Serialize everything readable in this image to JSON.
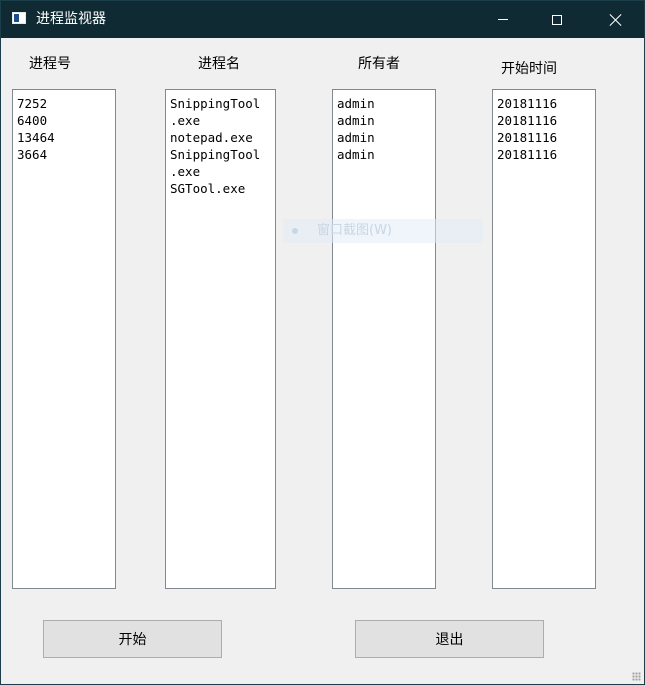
{
  "window": {
    "title": "进程监视器"
  },
  "columns": {
    "pid": {
      "label": "进程号",
      "items": [
        "7252",
        "6400",
        "13464",
        "3664"
      ]
    },
    "name": {
      "label": "进程名",
      "items": [
        "SnippingTool",
        ".exe",
        "notepad.exe",
        "SnippingTool",
        ".exe",
        "SGTool.exe"
      ]
    },
    "owner": {
      "label": "所有者",
      "items": [
        "admin",
        "admin",
        "admin",
        "admin"
      ]
    },
    "start_time": {
      "label": "开始时间",
      "items": [
        "20181116",
        "20181116",
        "20181116",
        "20181116"
      ]
    }
  },
  "overlay": {
    "menu_item": "窗口截图(W)"
  },
  "buttons": {
    "start": "开始",
    "exit": "退出"
  },
  "icons": {
    "app": "app-window-icon",
    "minimize": "minimize-icon",
    "maximize": "maximize-icon",
    "close": "close-icon",
    "grip": "resize-grip-icon"
  }
}
